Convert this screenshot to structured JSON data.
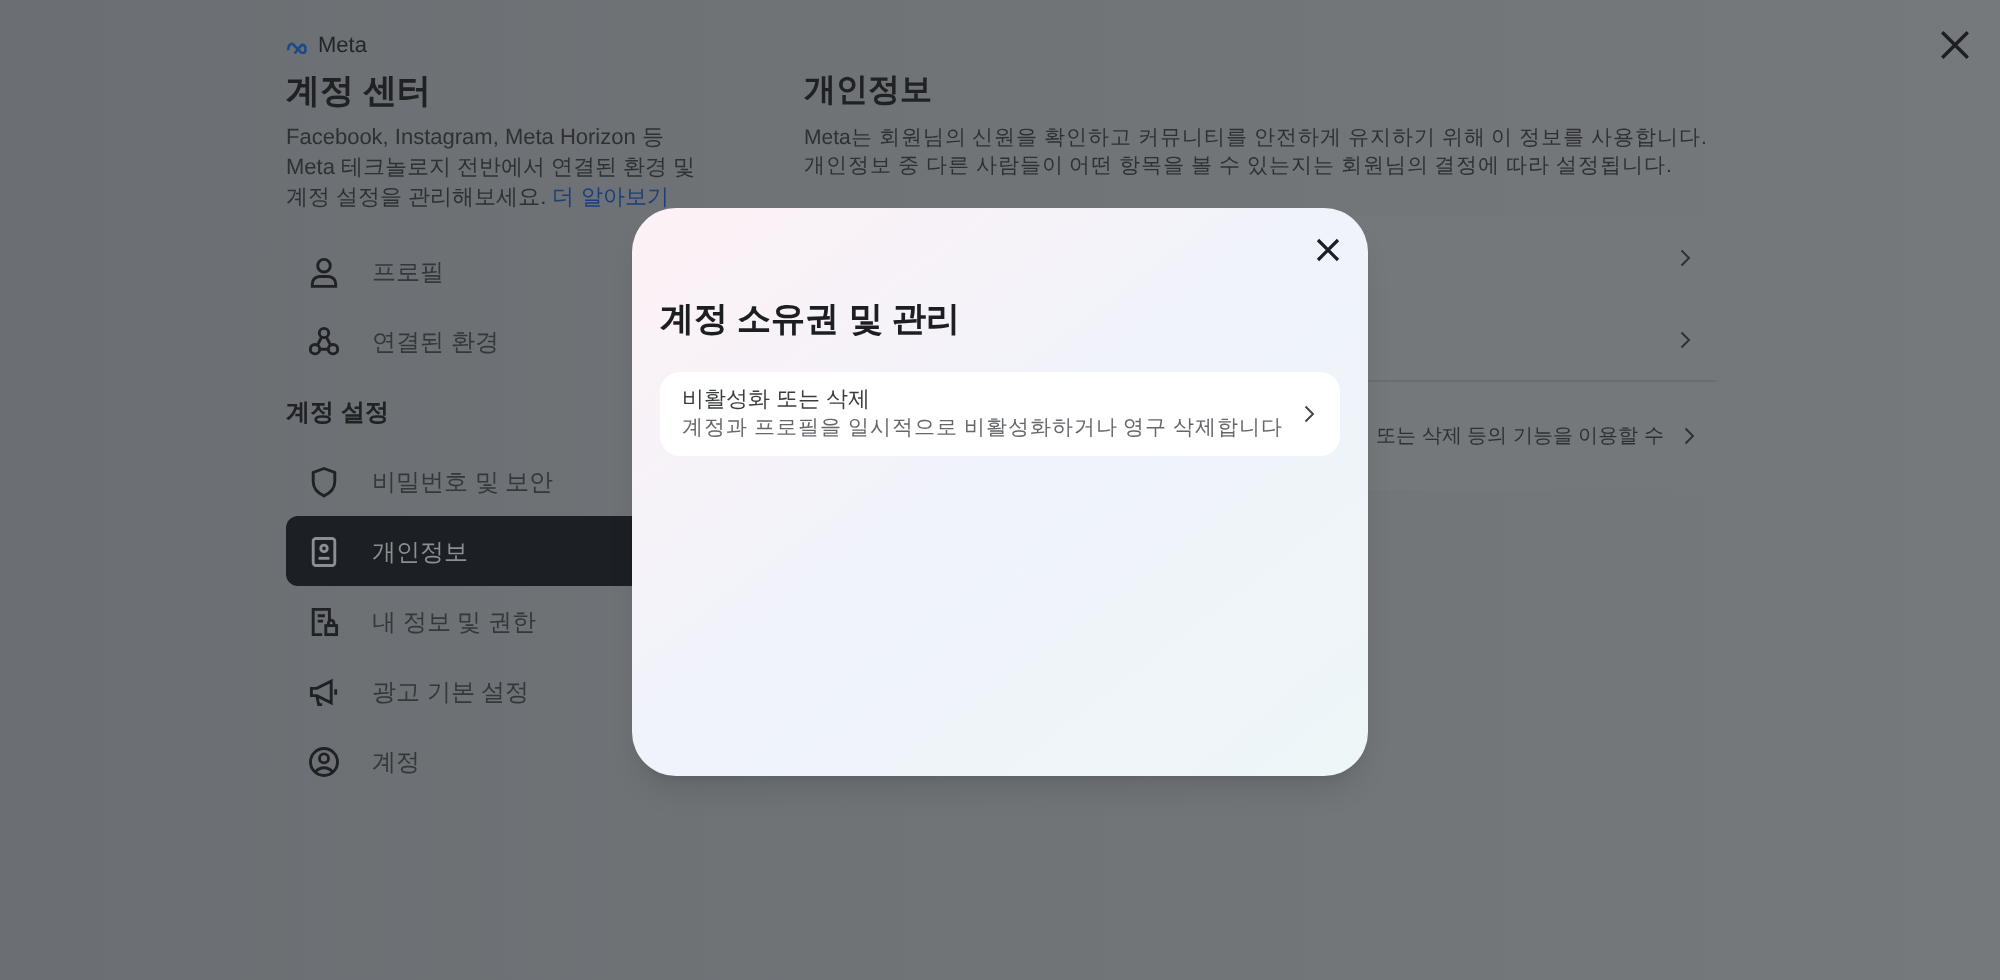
{
  "brand": "Meta",
  "sidebar": {
    "title": "계정 센터",
    "description": "Facebook, Instagram, Meta Horizon 등 Meta 테크놀로지 전반에서 연결된 환경 및 계정 설정을 관리해보세요.",
    "link": "더 알아보기",
    "items": [
      {
        "kind": "item",
        "label": "프로필",
        "selected": false
      },
      {
        "kind": "item",
        "label": "연결된 환경",
        "selected": false
      },
      {
        "kind": "header",
        "label": "계정 설정"
      },
      {
        "kind": "item",
        "label": "비밀번호 및 보안",
        "selected": false
      },
      {
        "kind": "item",
        "label": "개인정보",
        "selected": true
      },
      {
        "kind": "item",
        "label": "내 정보 및 권한",
        "selected": false
      },
      {
        "kind": "item",
        "label": "광고 기본 설정",
        "selected": false
      },
      {
        "kind": "item",
        "label": "계정",
        "selected": false
      }
    ]
  },
  "main": {
    "title": "개인정보",
    "description": "Meta는 회원님의 신원을 확인하고 커뮤니티를 안전하게 유지하기 위해 이 정보를 사용합니다. 개인정보 중 다른 사람들이 어떤 항목을 볼 수 있는지는 회원님의 결정에 따라 설정됩니다.",
    "rows": [
      {
        "kind": "plain"
      },
      {
        "kind": "plain"
      },
      {
        "kind": "text",
        "text": "또는 삭제 등의 기능을 이용할 수"
      }
    ]
  },
  "dialog": {
    "title": "계정 소유권 및 관리",
    "options": [
      {
        "title": "비활성화 또는 삭제",
        "subtitle": "계정과 프로필을 일시적으로 비활성화하거나 영구 삭제합니다"
      }
    ]
  }
}
